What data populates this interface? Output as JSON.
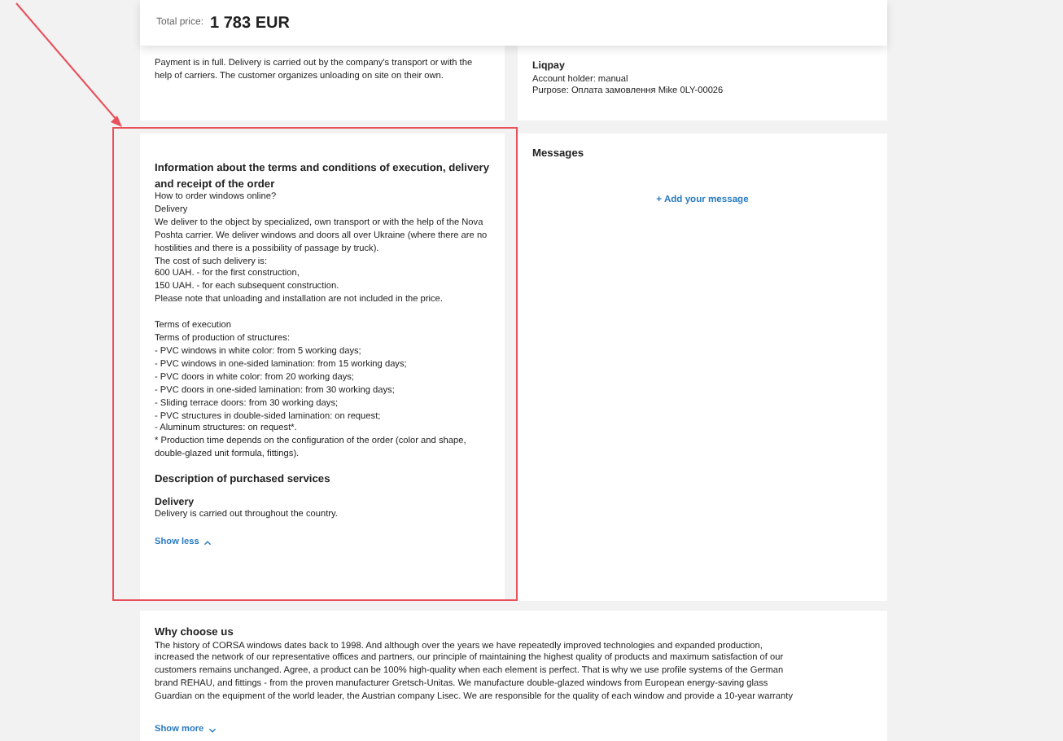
{
  "total": {
    "label": "Total price:",
    "value": "1 783 EUR"
  },
  "order_info": {
    "text": "Payment is in full. Delivery is carried out by the company's transport or with the help of carriers. The customer organizes unloading on site on their own."
  },
  "payment": {
    "method": "Liqpay",
    "lines": [
      "Account holder: manual",
      "Purpose: Оплата замовлення Mike 0LY-00026"
    ]
  },
  "terms": {
    "title": "Information about the terms and conditions of execution, delivery and receipt of the order",
    "paragraphs": [
      [
        "How to order windows online?",
        "Delivery",
        "We deliver to the object by specialized, own transport or with the help of the Nova Poshta carrier. We deliver windows and doors all over Ukraine (where there are no hostilities and there is a possibility of passage by truck).",
        "The cost of such delivery is:",
        "600 UAH. - for the first construction,",
        "150 UAH. - for each subsequent construction.",
        "Please note that unloading and installation are not included in the price."
      ],
      [
        "Terms of execution",
        "Terms of production of structures:",
        "- PVC windows in white color: from 5 working days;",
        "- PVC windows in one-sided lamination: from 15 working days;",
        "- PVC doors in white color: from 20 working days;",
        "- PVC doors in one-sided lamination: from 30 working days;",
        "- Sliding terrace doors: from 30 working days;",
        "- PVC structures in double-sided lamination: on request;",
        "- Aluminum structures: on request*.",
        "* Production time depends on the configuration of the order (color and shape, double-glazed unit formula, fittings)."
      ]
    ],
    "services_title": "Description of purchased services",
    "service": {
      "name": "Delivery",
      "text": "Delivery is carried out throughout the country."
    },
    "toggle": {
      "label": "Show less",
      "expanded": true
    }
  },
  "messages": {
    "title": "Messages",
    "add": "+ Add your message"
  },
  "why": {
    "title": "Why choose us",
    "lines": [
      "The history of CORSA windows dates back to 1998. And although over the years we have repeatedly improved technologies and expanded production,",
      "increased the network of our representative offices and partners, our principle of maintaining the highest quality of products and maximum satisfaction of our",
      "customers remains unchanged. Agree, a product can be 100% high-quality when each element is perfect. That is why we use profile systems of the German",
      "brand REHAU, and fittings - from the proven manufacturer Gretsch-Unitas. We manufacture double-glazed windows from European energy-saving glass",
      "Guardian on the equipment of the world leader, the Austrian company Lisec. We are responsible for the quality of each window and provide a 10-year warranty"
    ],
    "toggle": {
      "label": "Show more",
      "expanded": false
    }
  }
}
